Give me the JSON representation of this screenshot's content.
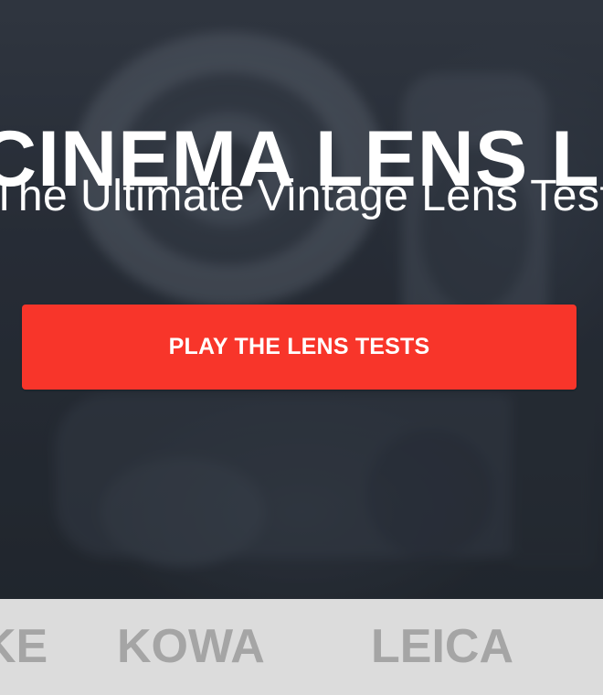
{
  "hero": {
    "title": "CINEMA LENS LIBRARY",
    "subtitle": "The Ultimate Vintage Lens Test",
    "cta_label": "PLAY THE LENS TESTS"
  },
  "brands": {
    "items": [
      "KE",
      "KOWA",
      "LEICA"
    ]
  },
  "colors": {
    "accent": "#f8352a",
    "hero_bg": "#2c323c",
    "brand_strip_bg": "#dcdcdc",
    "brand_text": "#a5a5a5"
  }
}
